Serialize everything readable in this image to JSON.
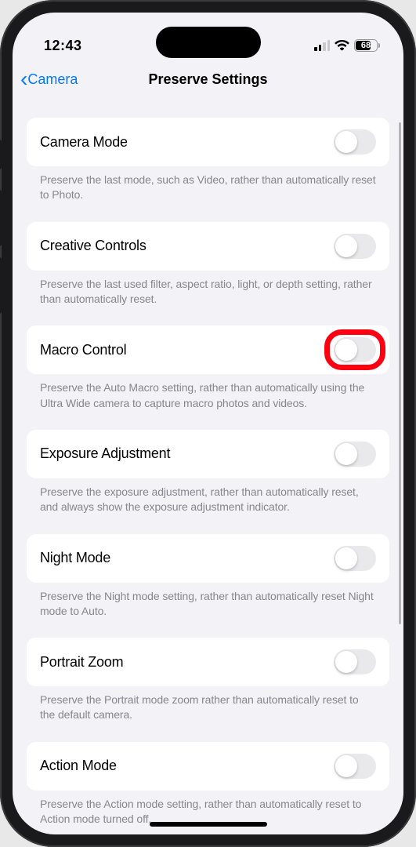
{
  "status": {
    "time": "12:43",
    "battery_pct": "68"
  },
  "nav": {
    "back_label": "Camera",
    "title": "Preserve Settings"
  },
  "settings": {
    "camera_mode": {
      "label": "Camera Mode",
      "description": "Preserve the last mode, such as Video, rather than automatically reset to Photo."
    },
    "creative_controls": {
      "label": "Creative Controls",
      "description": "Preserve the last used filter, aspect ratio, light, or depth setting, rather than automatically reset."
    },
    "macro_control": {
      "label": "Macro Control",
      "description": "Preserve the Auto Macro setting, rather than automatically using the Ultra Wide camera to capture macro photos and videos."
    },
    "exposure_adjustment": {
      "label": "Exposure Adjustment",
      "description": "Preserve the exposure adjustment, rather than automatically reset, and always show the exposure adjustment indicator."
    },
    "night_mode": {
      "label": "Night Mode",
      "description": "Preserve the Night mode setting, rather than automatically reset Night mode to Auto."
    },
    "portrait_zoom": {
      "label": "Portrait Zoom",
      "description": "Preserve the Portrait mode zoom rather than automatically reset to the default camera."
    },
    "action_mode": {
      "label": "Action Mode",
      "description": "Preserve the Action mode setting, rather than automatically reset to Action mode turned off."
    }
  }
}
